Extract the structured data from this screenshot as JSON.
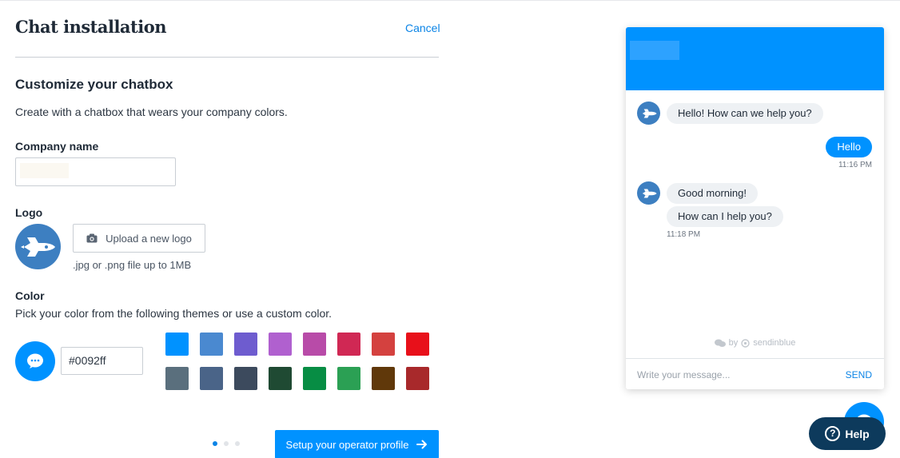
{
  "header": {
    "title": "Chat installation",
    "cancel_label": "Cancel"
  },
  "customize": {
    "title": "Customize your chatbox",
    "description": "Create with a chatbox that wears your company colors."
  },
  "company": {
    "label": "Company name",
    "value": ""
  },
  "logo": {
    "label": "Logo",
    "upload_label": "Upload a new logo",
    "hint": ".jpg or .png file up to 1MB",
    "icon": "rocket-icon"
  },
  "color": {
    "label": "Color",
    "description": "Pick your color from the following themes or use a custom color.",
    "value": "#0092ff",
    "swatches": [
      "#0092ff",
      "#4a89d0",
      "#6e5ccf",
      "#b060cf",
      "#b84ba8",
      "#d02854",
      "#d4413f",
      "#e8101a",
      "#5a6f7d",
      "#4a6488",
      "#3c4a5d",
      "#1f4a33",
      "#078d44",
      "#2ba054",
      "#60380a",
      "#a8292b"
    ]
  },
  "footer": {
    "next_label": "Setup your operator profile",
    "steps_total": 3,
    "step_current": 1
  },
  "chat": {
    "accent": "#0092ff",
    "messages": [
      {
        "from": "operator",
        "text": "Hello! How can we help you?"
      },
      {
        "from": "visitor",
        "text": "Hello",
        "time": "11:16 PM"
      },
      {
        "from": "operator",
        "text": "Good morning!"
      },
      {
        "from": "operator",
        "text": "How can I help you?",
        "time": "11:18 PM"
      }
    ],
    "powered_by_prefix": "by",
    "powered_by_brand": "sendinblue",
    "input_placeholder": "Write your message...",
    "send_label": "SEND"
  },
  "help": {
    "label": "Help"
  }
}
